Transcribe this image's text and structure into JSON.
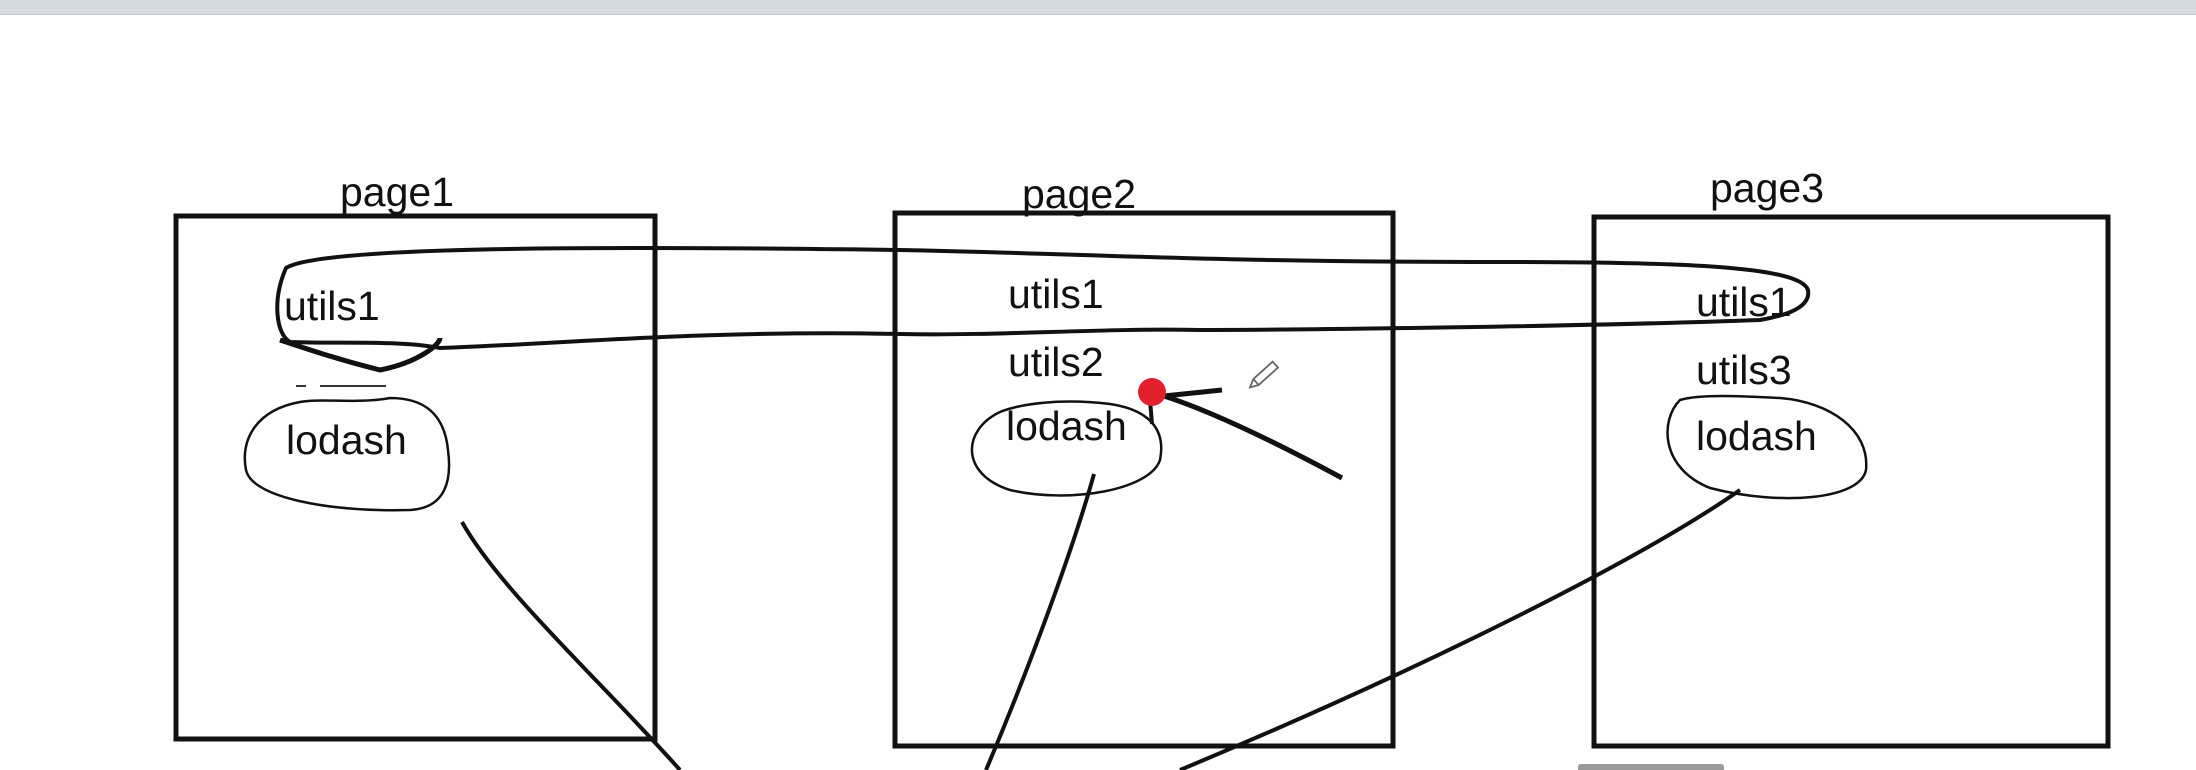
{
  "pages": [
    {
      "title": "page1",
      "items": [
        "utils1",
        "lodash"
      ]
    },
    {
      "title": "page2",
      "items": [
        "utils1",
        "utils2",
        "lodash"
      ]
    },
    {
      "title": "page3",
      "items": [
        "utils1",
        "utils3",
        "lodash"
      ]
    }
  ],
  "colors": {
    "ink": "#111111",
    "pointer": "#e0202a",
    "toolbar": "#d5d9e0",
    "scrollbar": "#9a9a9a"
  },
  "icons": [
    "pencil-icon"
  ]
}
